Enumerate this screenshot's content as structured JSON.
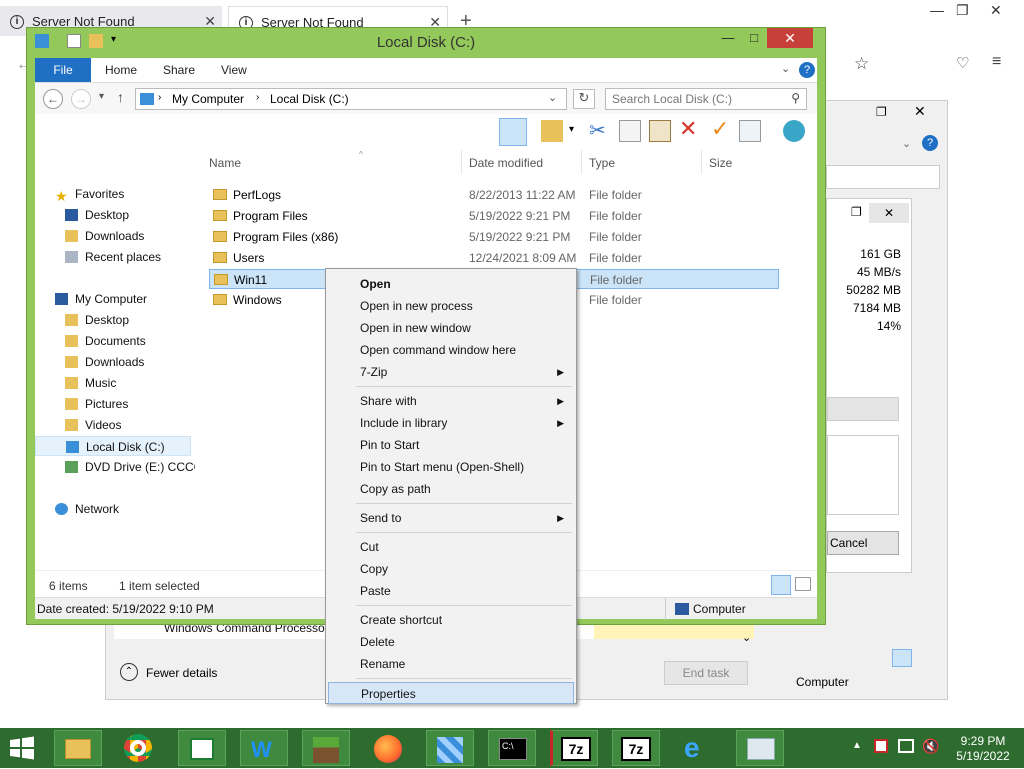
{
  "browser": {
    "tabs": [
      {
        "label": "Server Not Found"
      },
      {
        "label": "Server Not Found"
      }
    ],
    "new_tab": "+"
  },
  "explorer": {
    "title": "Local Disk (C:)",
    "ribbon_tabs": [
      "File",
      "Home",
      "Share",
      "View"
    ],
    "breadcrumb": [
      "My Computer",
      "Local Disk (C:)"
    ],
    "search_placeholder": "Search Local Disk (C:)",
    "columns": [
      "Name",
      "Date modified",
      "Type",
      "Size"
    ],
    "nav": {
      "favorites": {
        "label": "Favorites",
        "items": [
          "Desktop",
          "Downloads",
          "Recent places"
        ]
      },
      "computer": {
        "label": "My Computer",
        "items": [
          "Desktop",
          "Documents",
          "Downloads",
          "Music",
          "Pictures",
          "Videos",
          "Local Disk (C:)",
          "DVD Drive (E:) CCCC"
        ]
      },
      "network": {
        "label": "Network"
      }
    },
    "files": [
      {
        "name": "PerfLogs",
        "date": "8/22/2013 11:22 AM",
        "type": "File folder"
      },
      {
        "name": "Program Files",
        "date": "5/19/2022 9:21 PM",
        "type": "File folder"
      },
      {
        "name": "Program Files (x86)",
        "date": "5/19/2022 9:21 PM",
        "type": "File folder"
      },
      {
        "name": "Users",
        "date": "12/24/2021 8:09 AM",
        "type": "File folder"
      },
      {
        "name": "Win11",
        "date": "",
        "type": "File folder"
      },
      {
        "name": "Windows",
        "date": "",
        "type": "File folder"
      }
    ],
    "status": {
      "count": "6 items",
      "selected": "1 item selected",
      "created": "Date created: 5/19/2022 9:10 PM",
      "location": "Computer"
    }
  },
  "taskmgr": {
    "stats": [
      "161 GB",
      "45 MB/s",
      "50282 MB",
      "7184 MB",
      "14%"
    ],
    "fewer_details": "Fewer details",
    "end_task": "End task",
    "cancel": "Cancel",
    "computer": "Computer",
    "behind_row": "Windows Command Processor"
  },
  "context_menu": {
    "items": [
      "Open",
      "Open in new process",
      "Open in new window",
      "Open command window here",
      "7-Zip",
      "Share with",
      "Include in library",
      "Pin to Start",
      "Pin to Start menu (Open-Shell)",
      "Copy as path",
      "Send to",
      "Cut",
      "Copy",
      "Paste",
      "Create shortcut",
      "Delete",
      "Rename",
      "Properties"
    ]
  },
  "clock": {
    "time": "9:29 PM",
    "date": "5/19/2022"
  },
  "colors": {
    "window_frame": "#93c95a",
    "taskbar": "#2e6b2e",
    "selection": "#cce4f7",
    "close": "#c7403a"
  }
}
